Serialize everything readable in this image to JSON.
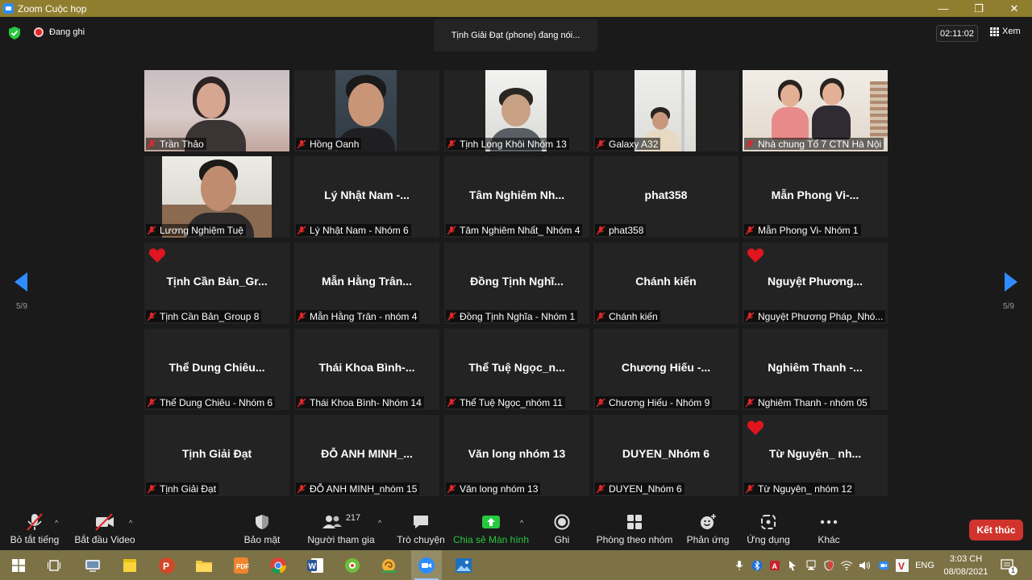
{
  "window": {
    "title": "Zoom Cuộc họp",
    "controls": [
      "—",
      "❐",
      "✕"
    ]
  },
  "topbar": {
    "recording_label": "Đang ghi",
    "speaking": "Tịnh Giải Đạt (phone) đang nói...",
    "timer": "02:11:02",
    "view_label": "Xem"
  },
  "pagination": {
    "left": "5/9",
    "right": "5/9"
  },
  "tiles": [
    {
      "label": "Trần Thảo"
    },
    {
      "label": "Hồng Oanh"
    },
    {
      "label": "Tịnh Long Khôi Nhóm 13"
    },
    {
      "label": "Galaxy A32"
    },
    {
      "label": "Nhà chung Tổ 7 CTN Hà Nội"
    },
    {
      "label": "Lương Nghiệm Tuệ"
    },
    {
      "big": "Lý Nhật Nam -...",
      "label": "Lý Nhật Nam - Nhóm 6"
    },
    {
      "big": "Tâm Nghiêm Nh...",
      "label": "Tâm Nghiêm Nhất_ Nhóm 4"
    },
    {
      "big": "phat358",
      "label": "phat358"
    },
    {
      "big": "Mẫn Phong Vi-...",
      "label": "Mẫn Phong Vi- Nhóm 1"
    },
    {
      "big": "Tịnh Cần Bản_Gr...",
      "label": "Tịnh Cần Bản_Group 8"
    },
    {
      "big": "Mẫn Hằng Trân...",
      "label": "Mẫn Hằng Trân - nhóm 4"
    },
    {
      "big": "Đồng Tịnh Nghĩ...",
      "label": "Đồng Tịnh Nghĩa - Nhóm 1"
    },
    {
      "big": "Chánh kiến",
      "label": "Chánh kiến"
    },
    {
      "big": "Nguyệt Phương...",
      "label": "Nguyệt Phương Pháp_Nhó..."
    },
    {
      "big": "Thể Dung Chiêu...",
      "label": "Thể Dung Chiêu - Nhóm 6"
    },
    {
      "big": "Thái Khoa Bình-...",
      "label": "Thái Khoa Bình- Nhóm 14"
    },
    {
      "big": "Thể Tuệ Ngọc_n...",
      "label": "Thể Tuệ Ngọc_nhóm 11"
    },
    {
      "big": "Chương Hiếu -...",
      "label": "Chương Hiếu - Nhóm 9"
    },
    {
      "big": "Nghiêm Thanh -...",
      "label": "Nghiêm Thanh - nhóm 05"
    },
    {
      "big": "Tịnh Giải Đạt",
      "label": "Tịnh Giải Đạt"
    },
    {
      "big": "ĐỖ ANH MINH_...",
      "label": "ĐỖ ANH MINH_nhóm 15"
    },
    {
      "big": "Văn long nhóm 13",
      "label": "Văn long nhóm 13"
    },
    {
      "big": "DUYEN_Nhóm 6",
      "label": "DUYEN_Nhóm 6"
    },
    {
      "big": "Từ Nguyên_ nh...",
      "label": "Từ Nguyên_ nhóm 12"
    }
  ],
  "toolbar": {
    "mute_all": "Bỏ tắt tiếng",
    "start_video": "Bắt đầu Video",
    "security": "Bảo mật",
    "participants": "Người tham gia",
    "participant_count": "217",
    "chat": "Trò chuyện",
    "share_screen": "Chia sẻ Màn hình",
    "record": "Ghi",
    "breakout": "Phòng theo nhóm",
    "reactions": "Phản ứng",
    "apps": "Ứng dụng",
    "more": "Khác",
    "end": "Kết thúc"
  },
  "taskbar": {
    "language": "ENG",
    "time": "3:03 CH",
    "date": "08/08/2021",
    "notification_count": "1"
  },
  "colors": {
    "accent": "#2d8cff",
    "end": "#d0342c",
    "share": "#27c93f",
    "mute": "#e02828"
  }
}
